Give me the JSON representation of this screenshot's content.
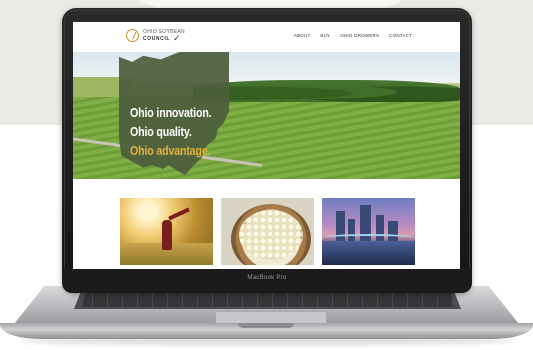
{
  "device": {
    "model_label": "MacBook Pro"
  },
  "site": {
    "logo": {
      "line1": "OHIO SOYBEAN",
      "line2": "COUNCIL",
      "check": "✓"
    },
    "nav": [
      {
        "label": "ABOUT"
      },
      {
        "label": "BUY"
      },
      {
        "label": "OHIO GROWERS"
      },
      {
        "label": "CONTACT"
      }
    ],
    "hero": {
      "line1": "Ohio innovation.",
      "line2": "Ohio quality.",
      "line3": "Ohio advantage."
    },
    "gallery_icons": [
      "girl-in-field-photo",
      "soybean-bowl-photo",
      "city-skyline-photo"
    ]
  },
  "colors": {
    "accent": "#e2b13a",
    "ohio_shape": "#4e5e3c",
    "logo_gold": "#c7922f"
  }
}
